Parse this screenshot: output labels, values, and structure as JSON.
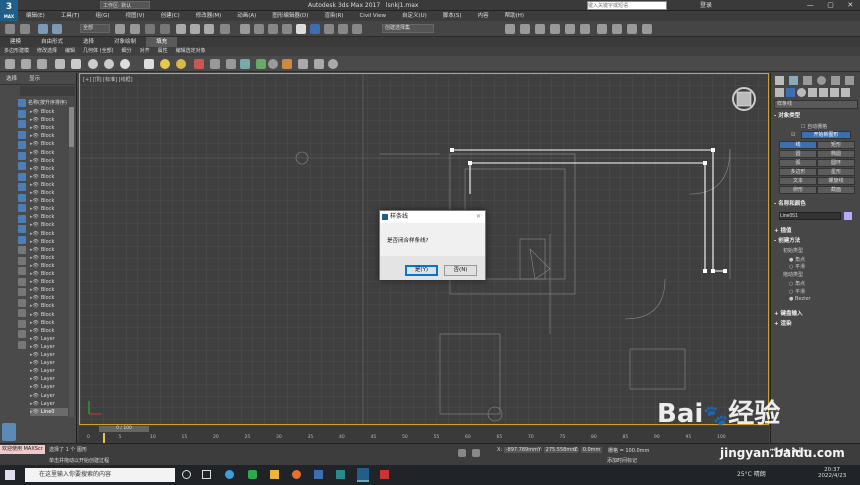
{
  "app": {
    "title": "Autodesk 3ds Max 2017",
    "file": "lsnkj1.max",
    "logo": "3",
    "logo_sub": "MAX",
    "workspace": "工作区: 默认",
    "search_placeholder": "键入关键字或短语",
    "user": "登录"
  },
  "menu": [
    "编辑(E)",
    "工具(T)",
    "组(G)",
    "视图(V)",
    "创建(C)",
    "修改器(M)",
    "动画(A)",
    "图形编辑器(D)",
    "渲染(R)",
    "Civil View",
    "自定义(U)",
    "脚本(S)",
    "内容",
    "帮助(H)"
  ],
  "toolbar": {
    "filter": "全部",
    "selection_set": "创建选择集"
  },
  "ribbon": {
    "tabs": [
      "建模",
      "自由形式",
      "选择",
      "对象绘制",
      "填充"
    ],
    "active": "填充",
    "sub": [
      "多边形建模",
      "修改选择",
      "编辑",
      "几何体 (全部)",
      "细分",
      "对齐",
      "属性",
      "编辑选定对象"
    ]
  },
  "scene": {
    "tabs": [
      "选择",
      "显示"
    ],
    "header": "名称(按升序排序)",
    "rows": [
      "Block",
      "Block",
      "Block",
      "Block",
      "Block",
      "Block",
      "Block",
      "Block",
      "Block",
      "Block",
      "Block",
      "Block",
      "Block",
      "Block",
      "Block",
      "Block",
      "Block",
      "Block",
      "Block",
      "Block",
      "Block",
      "Block",
      "Block",
      "Block",
      "Block",
      "Block",
      "Block",
      "Block",
      "Layer",
      "Layer",
      "Layer",
      "Layer",
      "Layer",
      "Layer",
      "Layer",
      "Layer",
      "Layer",
      "Line0"
    ]
  },
  "viewport": {
    "label": "[+] [顶] [标准] [线框]"
  },
  "dialog": {
    "title": "样条线",
    "message": "是否闭合样条线?",
    "yes": "是(Y)",
    "no": "否(N)"
  },
  "cmd": {
    "category": "样条线",
    "rollouts": [
      "对象类型",
      "名称和颜色",
      "插值",
      "创建方法",
      "键盘输入",
      "渲染"
    ],
    "autogrid": "自动栅格",
    "start_new_shape": "开始新图形",
    "objects": [
      "线",
      "矩形",
      "圆",
      "椭圆",
      "弧",
      "圆环",
      "多边形",
      "星形",
      "文本",
      "螺旋线",
      "卵形",
      "截面"
    ],
    "name": "Line051",
    "initial_type": "初始类型",
    "initial_opts": [
      "角点",
      "平滑"
    ],
    "drag_type": "拖动类型",
    "drag_opts": [
      "角点",
      "平滑",
      "Bezier"
    ]
  },
  "timeline": {
    "frame": "0 / 100",
    "ticks": [
      "0",
      "5",
      "10",
      "15",
      "20",
      "25",
      "30",
      "35",
      "40",
      "45",
      "50",
      "55",
      "60",
      "65",
      "70",
      "75",
      "80",
      "85",
      "90",
      "95",
      "100"
    ]
  },
  "status": {
    "welcome": "欢迎使用 MAXScr",
    "selected": "选择了 1 个 图形",
    "hint": "单击并拖动以开始创建过程",
    "x_label": "X:",
    "x": "-897.789mm",
    "y_label": "Y:",
    "y": "275.558mm",
    "z_label": "Z:",
    "z": "0.0mm",
    "grid": "栅格 = 100.0mm",
    "add_time": "添加时间标记"
  },
  "taskbar": {
    "search": "在这里输入你要搜索的内容",
    "weather": "25°C 晴朗",
    "time": "20:37",
    "date": "2022/4/23"
  },
  "watermark": {
    "text": "Bai",
    "text2": "经验",
    "url": "jingyan.baidu.com"
  },
  "colors": {
    "accent": "#3b6fb0",
    "viewport_border": "#c9a227",
    "spline": "#ffffff"
  }
}
